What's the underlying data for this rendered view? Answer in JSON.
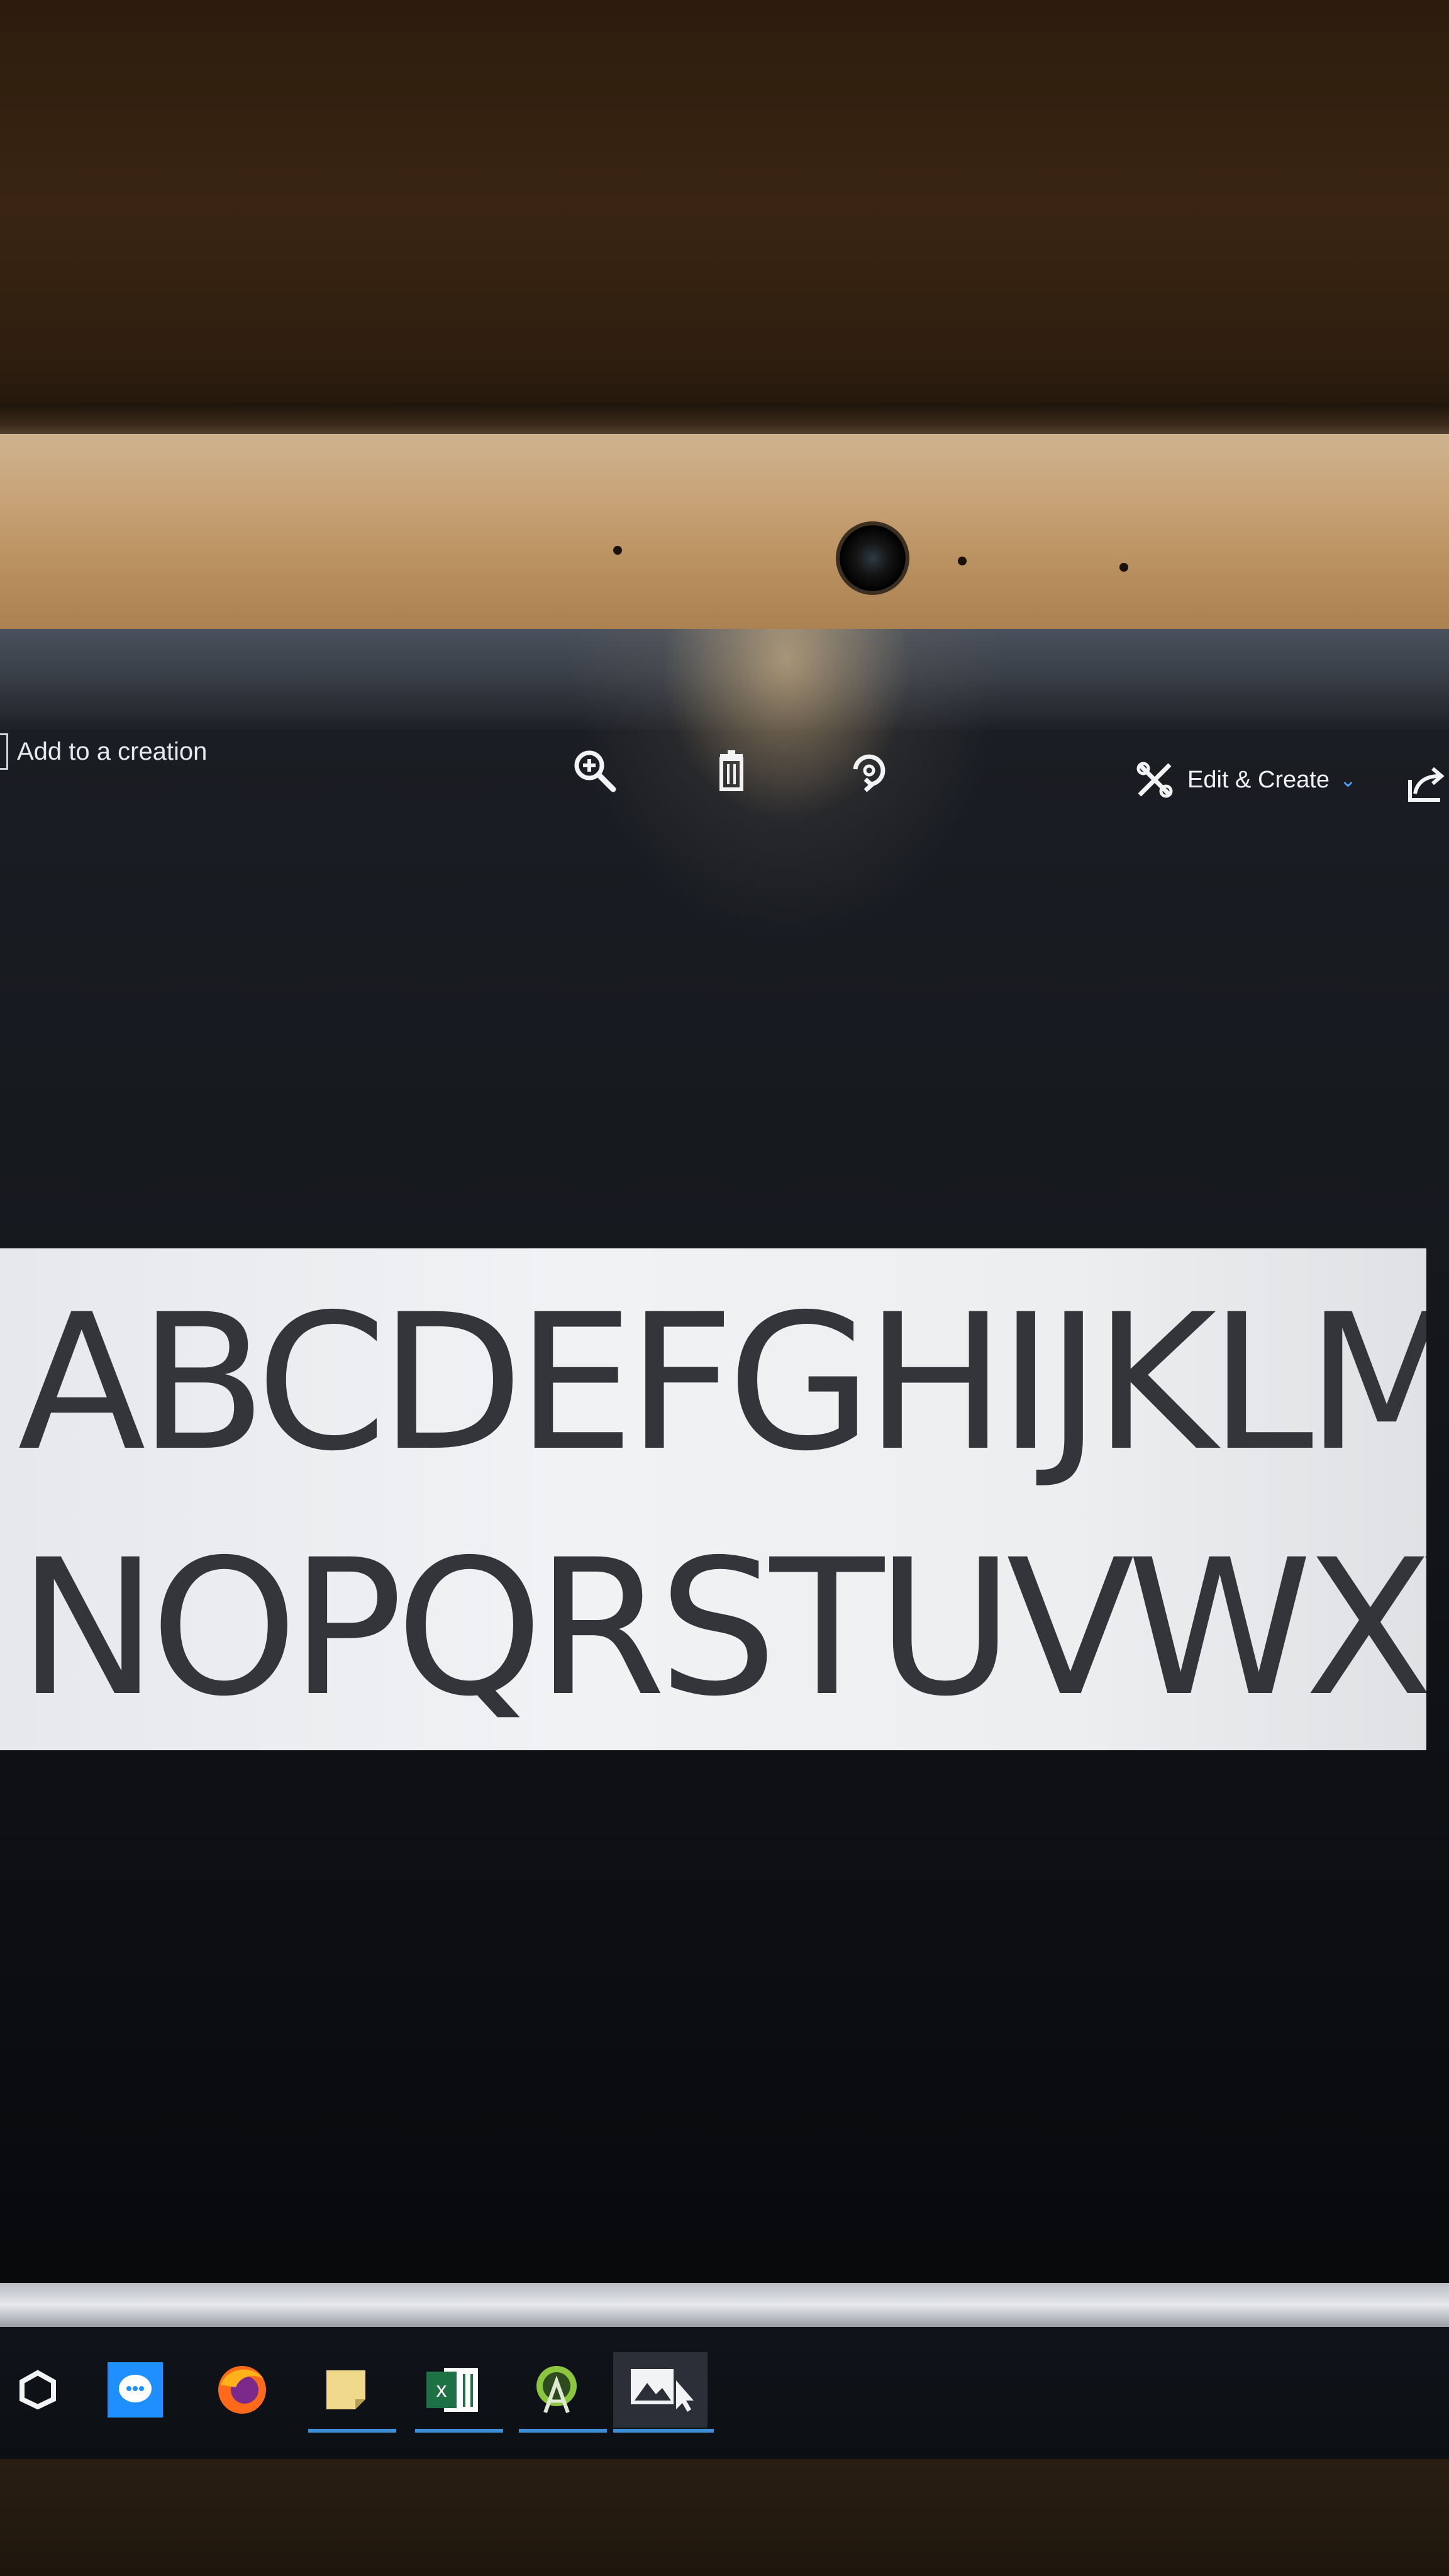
{
  "toolbar": {
    "add_to_creation_label": "Add to a creation",
    "edit_create_label": "Edit & Create",
    "icons": [
      "zoom-in-icon",
      "delete-icon",
      "rotate-icon",
      "edit-create-icon",
      "share-icon"
    ]
  },
  "image": {
    "line1": "ABCDEFGHIJKLM",
    "line2": "NOPQRSTUVWXYZ"
  },
  "taskbar": {
    "items": [
      "unity-icon",
      "messenger-icon",
      "firefox-icon",
      "sticky-notes-icon",
      "excel-icon",
      "android-studio-icon",
      "photos-icon"
    ]
  },
  "colors": {
    "screen_bg": "#15181d",
    "panel_bg": "#eceef0",
    "text": "#33353a",
    "accent": "#3d8fd8",
    "bezel": "#c9a57a"
  }
}
